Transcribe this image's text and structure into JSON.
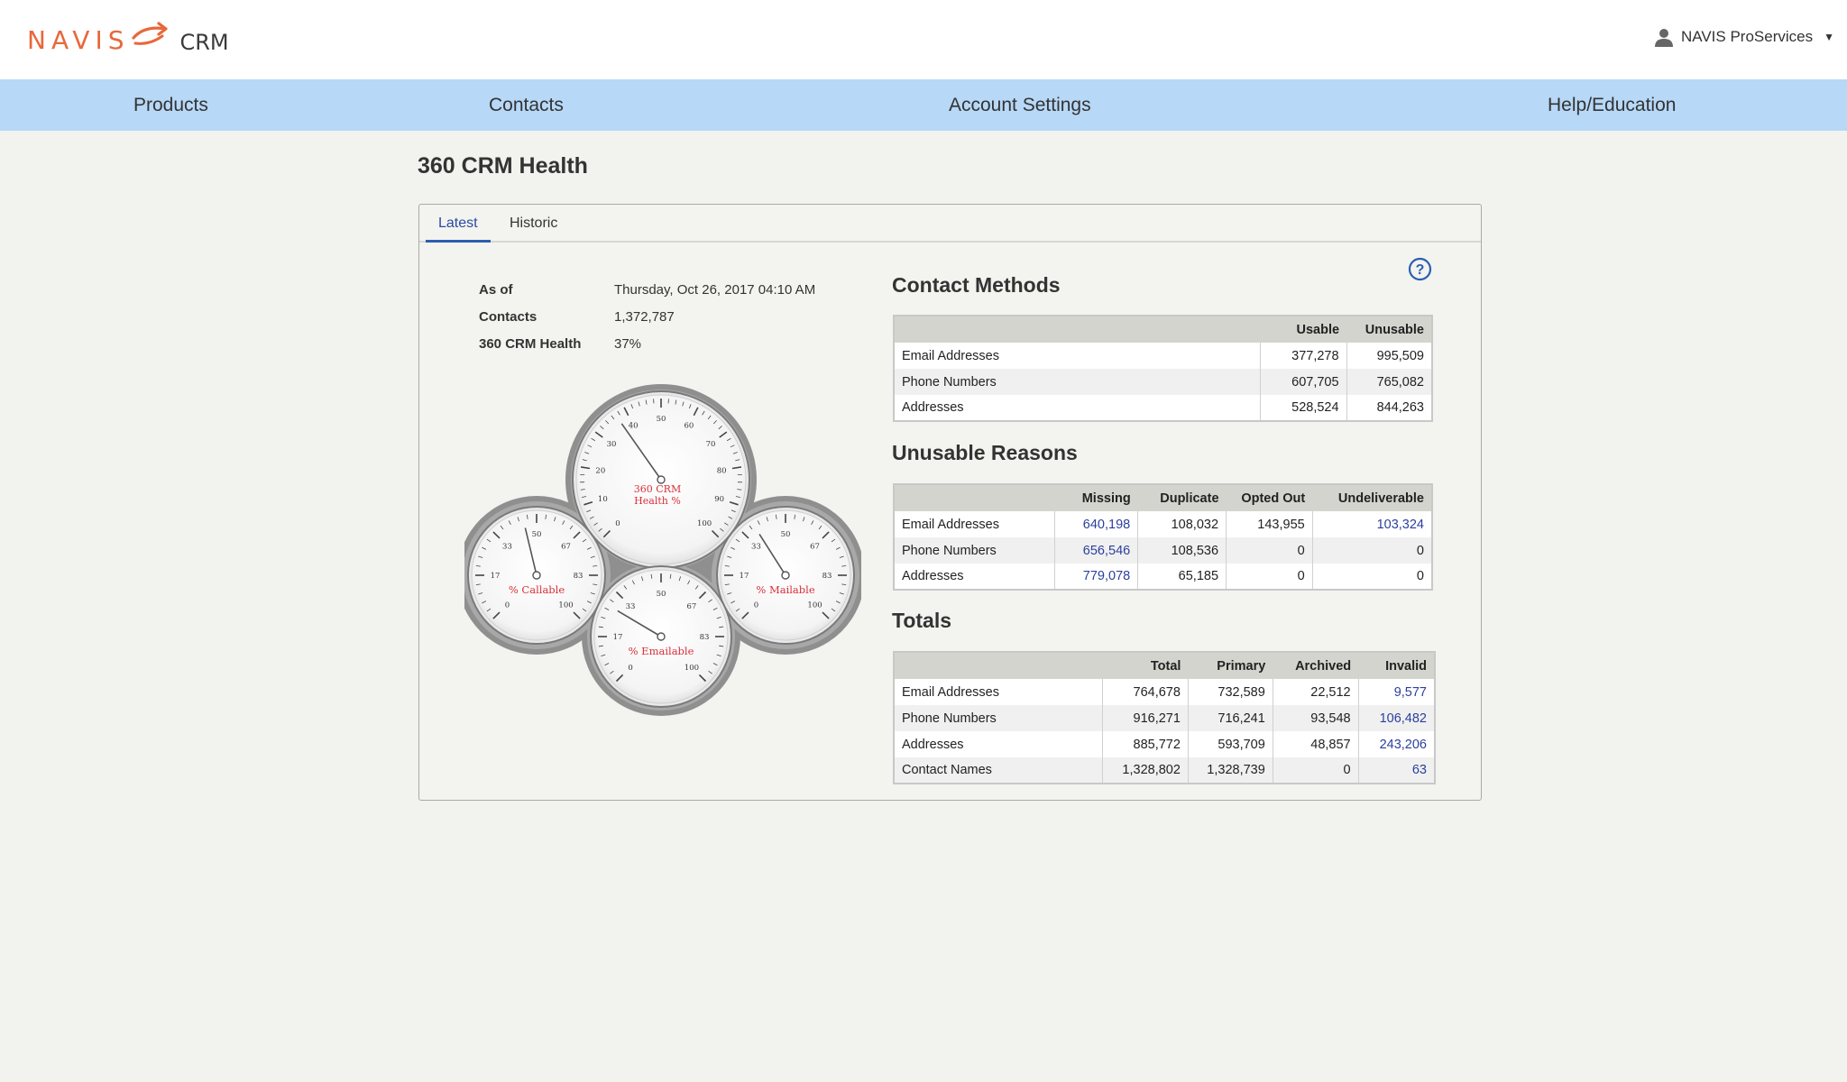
{
  "header": {
    "logo_text": "NAVIS",
    "logo_product": "CRM",
    "user_name": "NAVIS ProServices"
  },
  "nav": {
    "products": "Products",
    "contacts": "Contacts",
    "account_settings": "Account Settings",
    "help": "Help/Education"
  },
  "page_title": "360 CRM Health",
  "tabs": {
    "latest": "Latest",
    "historic": "Historic"
  },
  "summary": {
    "as_of_label": "As of",
    "as_of_value": "Thursday, Oct 26, 2017 04:10 AM",
    "contacts_label": "Contacts",
    "contacts_value": "1,372,787",
    "health_label": "360 CRM Health",
    "health_value": "37%"
  },
  "gauges": {
    "main": {
      "label_line1": "360 CRM",
      "label_line2": "Health %",
      "value": 37,
      "ticks": [
        "0",
        "10",
        "20",
        "30",
        "40",
        "50",
        "60",
        "70",
        "80",
        "90",
        "100"
      ]
    },
    "callable": {
      "label": "% Callable",
      "value": 45,
      "ticks": [
        "0",
        "17",
        "33",
        "50",
        "67",
        "83",
        "100"
      ]
    },
    "mailable": {
      "label": "% Mailable",
      "value": 38,
      "ticks": [
        "0",
        "17",
        "33",
        "50",
        "67",
        "83",
        "100"
      ]
    },
    "emailable": {
      "label": "% Emailable",
      "value": 28,
      "ticks": [
        "0",
        "17",
        "33",
        "50",
        "67",
        "83",
        "100"
      ]
    }
  },
  "gauge_tick_text": {
    "main": [
      "0",
      "10",
      "20",
      "30",
      "40",
      "50",
      "60",
      "70",
      "80",
      "90",
      "100"
    ],
    "small": [
      "0",
      "17",
      "33",
      "50",
      "67",
      "83",
      "100"
    ]
  },
  "contact_methods": {
    "title": "Contact Methods",
    "headers": [
      "",
      "Usable",
      "Unusable"
    ],
    "rows": [
      [
        "Email Addresses",
        "377,278",
        "995,509"
      ],
      [
        "Phone Numbers",
        "607,705",
        "765,082"
      ],
      [
        "Addresses",
        "528,524",
        "844,263"
      ]
    ]
  },
  "unusable_reasons": {
    "title": "Unusable Reasons",
    "headers": [
      "",
      "Missing",
      "Duplicate",
      "Opted Out",
      "Undeliverable"
    ],
    "rows": [
      [
        "Email Addresses",
        "640,198",
        "108,032",
        "143,955",
        "103,324"
      ],
      [
        "Phone Numbers",
        "656,546",
        "108,536",
        "0",
        "0"
      ],
      [
        "Addresses",
        "779,078",
        "65,185",
        "0",
        "0"
      ]
    ]
  },
  "totals": {
    "title": "Totals",
    "headers": [
      "",
      "Total",
      "Primary",
      "Archived",
      "Invalid"
    ],
    "rows": [
      [
        "Email Addresses",
        "764,678",
        "732,589",
        "22,512",
        "9,577"
      ],
      [
        "Phone Numbers",
        "916,271",
        "716,241",
        "93,548",
        "106,482"
      ],
      [
        "Addresses",
        "885,772",
        "593,709",
        "48,857",
        "243,206"
      ],
      [
        "Contact Names",
        "1,328,802",
        "1,328,739",
        "0",
        "63"
      ]
    ]
  },
  "colors": {
    "brand_orange": "#e8683a",
    "nav_blue": "#b7d8f7",
    "link_blue": "#2b3f9e",
    "gauge_label_red": "#d9303a"
  }
}
